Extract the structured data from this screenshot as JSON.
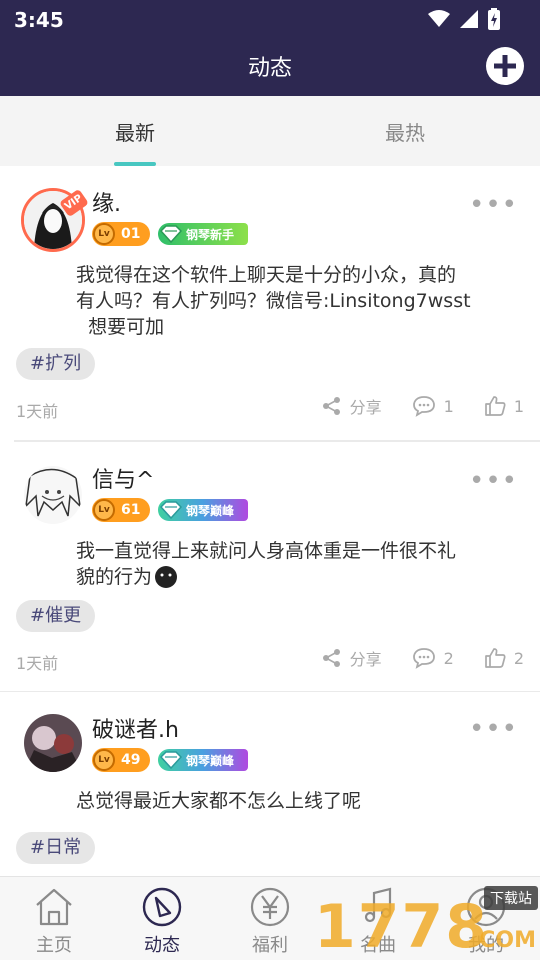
{
  "status": {
    "time": "3:45"
  },
  "header": {
    "title": "动态"
  },
  "tabs": [
    {
      "label": "最新"
    },
    {
      "label": "最热"
    }
  ],
  "posts": [
    {
      "username": "缘.",
      "level": "01",
      "level_prefix": "Lv",
      "vip_label": "VIP",
      "badge": "钢琴新手",
      "content_lines": [
        "我觉得在这个软件上聊天是十分的小众，真的",
        "有人吗？有人扩列吗？微信号:Linsitong7wsst",
        "  想要可加"
      ],
      "tag": "#扩列",
      "time": "1天前",
      "share_label": "分享",
      "comments": "1",
      "likes": "1"
    },
    {
      "username": "信与^",
      "level": "61",
      "level_prefix": "Lv",
      "badge": "钢琴巅峰",
      "content_lines": [
        "我一直觉得上来就问人身高体重是一件很不礼",
        "貌的行为"
      ],
      "tag": "#催更",
      "time": "1天前",
      "share_label": "分享",
      "comments": "2",
      "likes": "2"
    },
    {
      "username": "破谜者.h",
      "level": "49",
      "level_prefix": "Lv",
      "badge": "钢琴巅峰",
      "content_lines": [
        "总觉得最近大家都不怎么上线了呢"
      ],
      "tag": "#日常"
    }
  ],
  "bottom_nav": [
    {
      "label": "主页",
      "icon": "home-icon"
    },
    {
      "label": "动态",
      "icon": "compass-icon"
    },
    {
      "label": "福利",
      "icon": "yen-icon"
    },
    {
      "label": "名曲",
      "icon": "music-icon"
    },
    {
      "label": "我的",
      "icon": "profile-icon"
    }
  ],
  "watermark": {
    "text": "1778",
    "suffix": "下载站",
    "domain": "COM"
  },
  "colors": {
    "header_bg": "#2d2851",
    "tab_indicator": "#48c7c1",
    "level_badge": "#ff9e1f",
    "vip_ring": "#ff6a4d"
  }
}
